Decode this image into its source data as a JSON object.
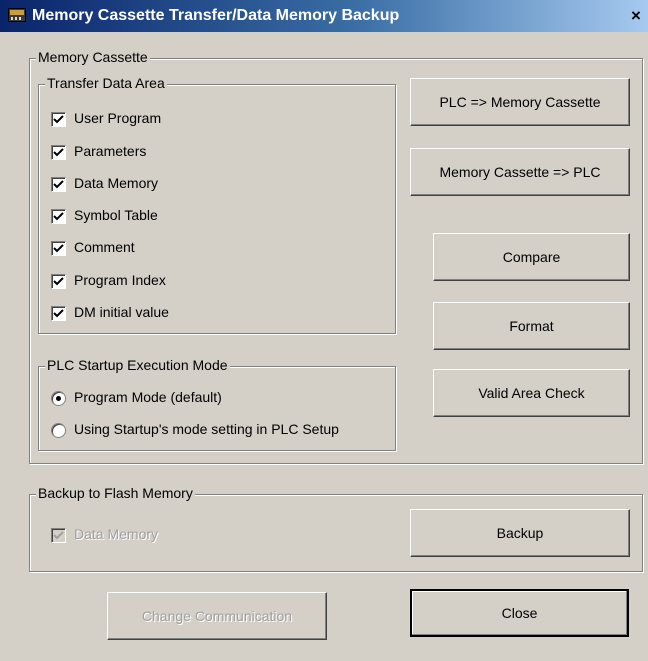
{
  "window": {
    "title": "Memory Cassette Transfer/Data Memory Backup",
    "close_glyph": "×"
  },
  "memory_cassette": {
    "label": "Memory Cassette",
    "transfer_area": {
      "label": "Transfer Data Area",
      "items": [
        {
          "label": "User Program",
          "checked": true
        },
        {
          "label": "Parameters",
          "checked": true
        },
        {
          "label": "Data Memory",
          "checked": true
        },
        {
          "label": "Symbol Table",
          "checked": true
        },
        {
          "label": "Comment",
          "checked": true
        },
        {
          "label": "Program Index",
          "checked": true
        },
        {
          "label": "DM initial value",
          "checked": true
        }
      ]
    },
    "startup_mode": {
      "label": "PLC Startup Execution Mode",
      "options": [
        {
          "label": "Program Mode (default)",
          "selected": true
        },
        {
          "label": "Using Startup's mode setting in PLC Setup",
          "selected": false
        }
      ]
    },
    "buttons": {
      "plc_to_cassette": "PLC  =>  Memory Cassette",
      "cassette_to_plc": "Memory Cassette  =>  PLC",
      "compare": "Compare",
      "format": "Format",
      "valid_area_check": "Valid Area Check"
    }
  },
  "backup": {
    "label": "Backup to Flash Memory",
    "data_memory": {
      "label": "Data Memory",
      "checked": true,
      "enabled": false
    },
    "backup_button": "Backup"
  },
  "footer": {
    "change_communication": "Change Communication",
    "close": "Close"
  },
  "icons": {
    "app_icon": "memory-cassette-icon",
    "checkmark": "checkmark-icon"
  }
}
